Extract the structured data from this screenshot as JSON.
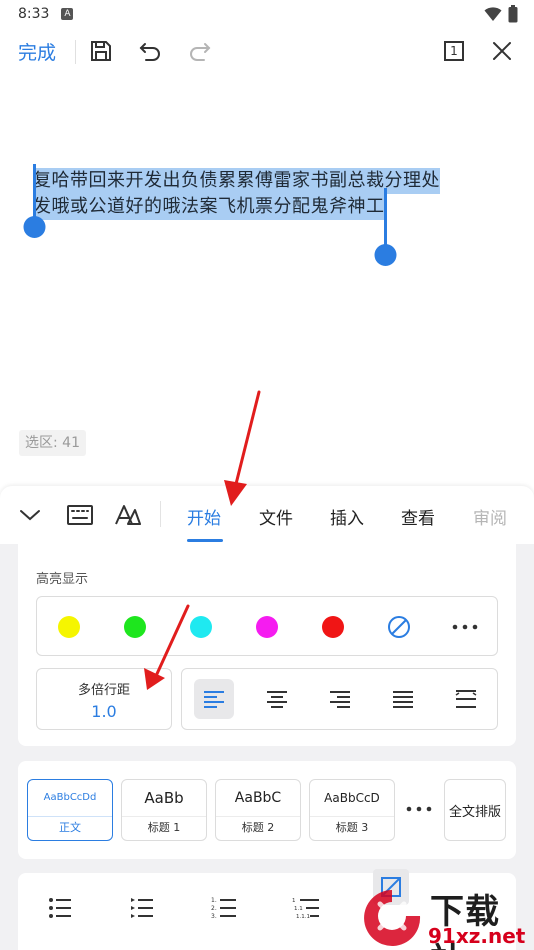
{
  "status_bar": {
    "time": "8:33",
    "badge": "A"
  },
  "toolbar": {
    "done_label": "完成",
    "page_count": "1"
  },
  "document": {
    "line1": "复哈带回来开发出负债累累傅雷家书副总裁分理处",
    "line2": "发哦或公道好的哦法案飞机票分配鬼斧神工",
    "selection_count": "选区: 41"
  },
  "tabs": [
    {
      "label": "开始"
    },
    {
      "label": "文件"
    },
    {
      "label": "插入"
    },
    {
      "label": "查看"
    },
    {
      "label": "审阅"
    }
  ],
  "highlight": {
    "title": "高亮显示",
    "colors": [
      "#f5f500",
      "#1ee61e",
      "#1fe9f0",
      "#f51cf0",
      "#f01515"
    ],
    "none_color": "#2b7de1"
  },
  "line_spacing": {
    "label": "多倍行距",
    "value": "1.0"
  },
  "styles": [
    {
      "sample": "AaBbCcDd",
      "name": "正文"
    },
    {
      "sample": "AaBb",
      "name": "标题 1"
    },
    {
      "sample": "AaBbC",
      "name": "标题 2"
    },
    {
      "sample": "AaBbCcD",
      "name": "标题 3"
    }
  ],
  "full_layout_label": "全文排版",
  "colors": {
    "accent": "#2b7de1",
    "selection": "#a9cdf3",
    "arrow": "#e11d1d"
  },
  "watermark": {
    "title": "下载站",
    "url": "91xz.net"
  }
}
